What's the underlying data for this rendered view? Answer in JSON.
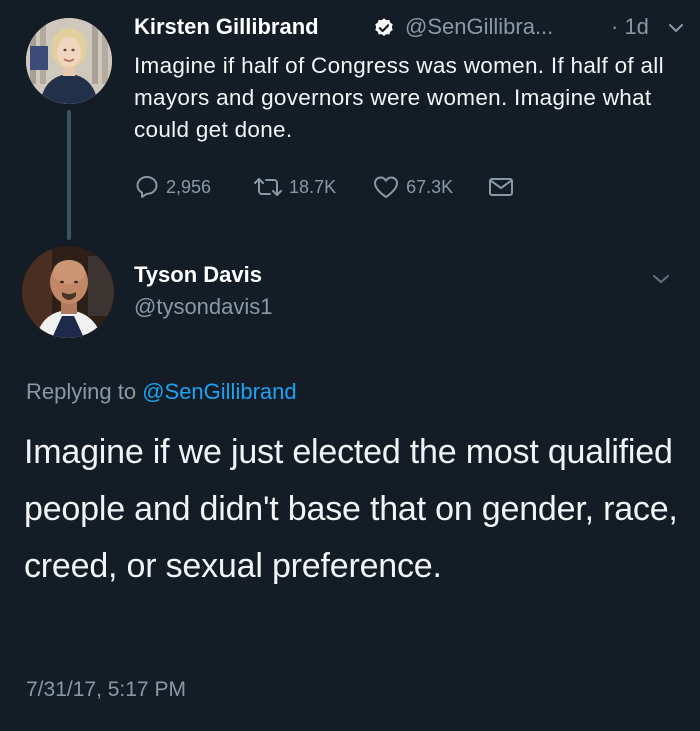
{
  "original_tweet": {
    "author_name": "Kirsten Gillibrand",
    "handle": "@SenGillibra...",
    "time": "· 1d",
    "text": "Imagine if half of Congress was women. If half of all mayors and governors were women. Imagine what could get done.",
    "stats": {
      "replies": "2,956",
      "retweets": "18.7K",
      "likes": "67.3K"
    },
    "icons": [
      "verified-badge-icon",
      "chevron-down-icon",
      "reply-icon",
      "retweet-icon",
      "heart-icon",
      "message-icon"
    ]
  },
  "reply_tweet": {
    "author_name": "Tyson Davis",
    "handle": "@tysondavis1",
    "replying_prefix": "Replying to ",
    "replying_mention": "@SenGillibrand",
    "text": "Imagine if we just elected the most qualified people and didn't base that on gender, race, creed, or sexual preference.",
    "timestamp": "7/31/17, 5:17 PM"
  },
  "colors": {
    "background": "#141d26",
    "text": "#f2f4f5",
    "secondary_text": "#8899a6",
    "link": "#1da1f2",
    "thread_line": "#3d5466"
  }
}
